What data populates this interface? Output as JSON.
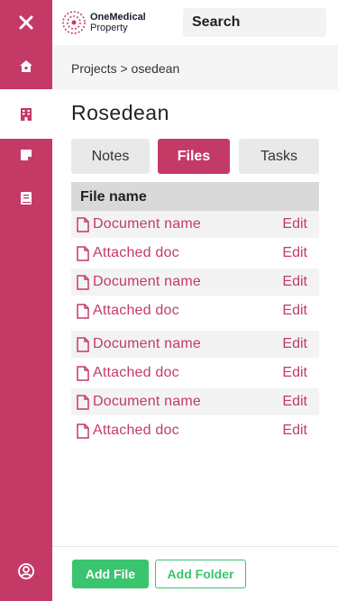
{
  "brand": {
    "line1": "OneMedical",
    "line2": "Property",
    "color": "#c43a66"
  },
  "search": {
    "placeholder": "Search"
  },
  "sidebar": {
    "items": [
      {
        "icon": "close-icon"
      },
      {
        "icon": "home-icon"
      },
      {
        "icon": "building-icon",
        "active": true
      },
      {
        "icon": "note-icon"
      },
      {
        "icon": "book-icon"
      },
      {
        "icon": "user-circle-icon"
      }
    ]
  },
  "breadcrumb": "Projects > osedean",
  "page_title": "Rosedean",
  "tabs": [
    {
      "label": "Notes",
      "active": false
    },
    {
      "label": "Files",
      "active": true
    },
    {
      "label": "Tasks",
      "active": false
    }
  ],
  "table": {
    "header": "File name",
    "action_label": "Edit",
    "rows": [
      {
        "name": "Document name"
      },
      {
        "name": "Attached doc"
      },
      {
        "name": "Document name"
      },
      {
        "name": "Attached doc"
      },
      {
        "name": "Document name"
      },
      {
        "name": "Attached doc"
      },
      {
        "name": "Document name"
      },
      {
        "name": "Attached doc"
      }
    ]
  },
  "actions": {
    "add_file": "Add File",
    "add_folder": "Add Folder",
    "accent": "#3bc46e"
  }
}
